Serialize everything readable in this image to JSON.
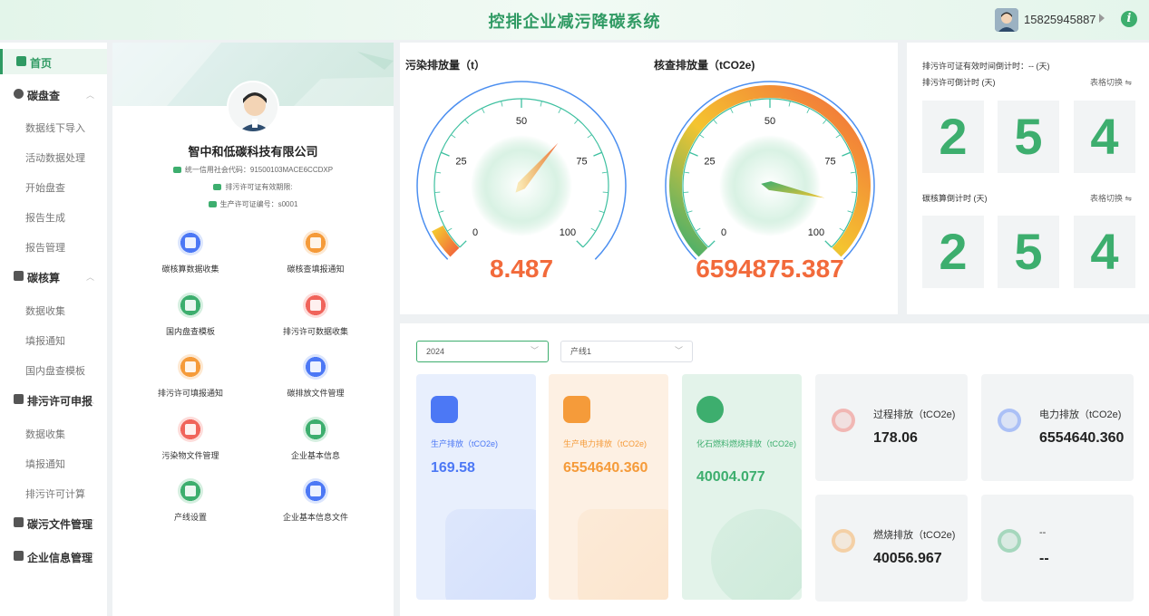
{
  "header": {
    "title": "控排企业减污降碳系统",
    "phone": "15825945887",
    "info_glyph": "i"
  },
  "sidebar": {
    "items": [
      {
        "label": "首页",
        "level": "top",
        "active": true,
        "icon": "home-icon"
      },
      {
        "label": "碳盘查",
        "level": "top",
        "icon": "carbon-check-icon",
        "chevron": "︿"
      },
      {
        "label": "数据线下导入",
        "level": "sub"
      },
      {
        "label": "活动数据处理",
        "level": "sub"
      },
      {
        "label": "开始盘查",
        "level": "sub"
      },
      {
        "label": "报告生成",
        "level": "sub"
      },
      {
        "label": "报告管理",
        "level": "sub"
      },
      {
        "label": "碳核算",
        "level": "top",
        "icon": "carbon-account-icon",
        "chevron": "︿"
      },
      {
        "label": "数据收集",
        "level": "sub"
      },
      {
        "label": "填报通知",
        "level": "sub"
      },
      {
        "label": "国内盘查模板",
        "level": "sub"
      },
      {
        "label": "排污许可申报",
        "level": "top",
        "icon": "permit-icon",
        "chevron": "︿"
      },
      {
        "label": "数据收集",
        "level": "sub"
      },
      {
        "label": "填报通知",
        "level": "sub"
      },
      {
        "label": "排污许可计算",
        "level": "sub"
      },
      {
        "label": "碳污文件管理",
        "level": "top",
        "icon": "folder-icon",
        "chevron": "﹀"
      },
      {
        "label": "企业信息管理",
        "level": "top",
        "icon": "building-icon",
        "chevron": "﹀"
      }
    ]
  },
  "company": {
    "name": "智中和低碳科技有限公司",
    "credit_code": "统一信用社会代码：91500103MACE6CCDXP",
    "permit_validity": "排污许可证有效期限:",
    "production_permit": "生产许可证编号：s0001",
    "quick_links": [
      {
        "label": "碳核算数据收集",
        "color": "blue"
      },
      {
        "label": "碳核查填报通知",
        "color": "orange"
      },
      {
        "label": "国内盘查模板",
        "color": "green"
      },
      {
        "label": "排污许可数据收集",
        "color": "red"
      },
      {
        "label": "排污许可填报通知",
        "color": "orange"
      },
      {
        "label": "碳排放文件管理",
        "color": "blue"
      },
      {
        "label": "污染物文件管理",
        "color": "red"
      },
      {
        "label": "企业基本信息",
        "color": "green"
      },
      {
        "label": "产线设置",
        "color": "green"
      },
      {
        "label": "企业基本信息文件",
        "color": "blue"
      }
    ]
  },
  "gauges": [
    {
      "title": "污染排放量（t）",
      "value": "8.487",
      "ticks": [
        "0",
        "25",
        "50",
        "75",
        "100"
      ],
      "needle_pct": 0.65
    },
    {
      "title": "核查排放量（tCO2e)",
      "value": "6594875.387",
      "ticks": [
        "0",
        "25",
        "50",
        "75",
        "100"
      ],
      "needle_pct": 0.88
    }
  ],
  "countdown": {
    "permit_valid_label": "排污许可证有效时间倒计时：-- (天)",
    "permit_countdown_label": "排污许可倒计时 (天)",
    "carbon_countdown_label": "碳核算倒计时 (天)",
    "switch_label": "表格切换 ⇋",
    "permit_digits": [
      "2",
      "5",
      "4"
    ],
    "carbon_digits": [
      "2",
      "5",
      "4"
    ]
  },
  "filters": {
    "year": "2024",
    "line": "产线1"
  },
  "cards": [
    {
      "label": "生产排放（tCO2e)",
      "value": "169.58",
      "color": "#4c78f5",
      "bg": "#e8effd",
      "icon": "monitor-chart-icon"
    },
    {
      "label": "生产电力排放（tCO2e)",
      "value": "6554640.360",
      "color": "#f59b3a",
      "bg": "#fdf0e3",
      "icon": "power-icon"
    },
    {
      "label": "化石燃料燃烧排放（tCO2e)",
      "value": "40004.077",
      "color": "#3dae6e",
      "bg": "#e3f3ea",
      "icon": "trend-icon"
    }
  ],
  "stats": [
    {
      "label": "过程排放（tCO2e)",
      "value": "178.06",
      "color": "#f0645b",
      "icon": "factory-icon"
    },
    {
      "label": "电力排放（tCO2e)",
      "value": "6554640.360",
      "color": "#4c78f5",
      "icon": "cloud-electric-icon"
    },
    {
      "label": "燃烧排放（tCO2e)",
      "value": "40056.967",
      "color": "#f59b3a",
      "icon": "fire-chart-icon"
    },
    {
      "label": "--",
      "value": "--",
      "color": "#3dae6e",
      "icon": "leaf-drop-icon"
    }
  ]
}
